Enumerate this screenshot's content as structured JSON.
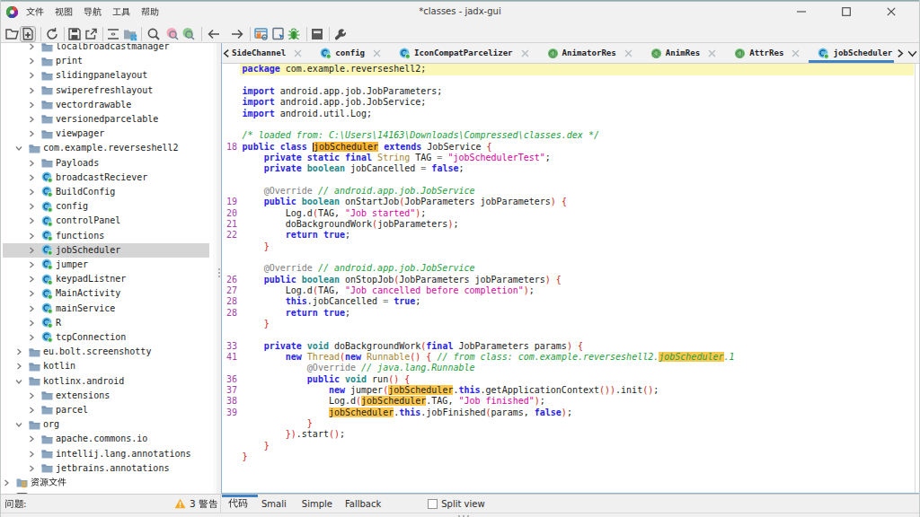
{
  "window": {
    "title": "*classes - jadx-gui",
    "controls": [
      {
        "icon": "minimize-icon"
      },
      {
        "icon": "maximize-icon"
      },
      {
        "icon": "close-icon"
      }
    ]
  },
  "menubar": {
    "items": [
      {
        "label": "文件"
      },
      {
        "label": "视图"
      },
      {
        "label": "导航"
      },
      {
        "label": "工具"
      },
      {
        "label": "帮助"
      }
    ]
  },
  "toolbar": {
    "items": [
      {
        "icon": "open-file-icon"
      },
      {
        "icon": "add-files-icon",
        "boxed": true
      },
      {
        "sep": true
      },
      {
        "icon": "reload-icon"
      },
      {
        "sep": true
      },
      {
        "icon": "save-all-icon"
      },
      {
        "icon": "export-icon"
      },
      {
        "sep": true
      },
      {
        "icon": "flatten-packages-icon"
      },
      {
        "icon": "packages-icon"
      },
      {
        "sep": true
      },
      {
        "icon": "search-icon"
      },
      {
        "icon": "text-search-icon"
      },
      {
        "icon": "class-search-icon"
      },
      {
        "sep": true
      },
      {
        "icon": "back-icon"
      },
      {
        "icon": "forward-icon"
      },
      {
        "sep": true
      },
      {
        "icon": "deobfuscation-icon"
      },
      {
        "icon": "quark-icon"
      },
      {
        "icon": "debug-icon"
      },
      {
        "sep": true
      },
      {
        "icon": "log-viewer-icon"
      },
      {
        "sep": true
      },
      {
        "icon": "settings-icon"
      }
    ]
  },
  "tree": {
    "items": [
      {
        "level": 2,
        "icon": "folder",
        "chev": "right",
        "label": "localbroadcastmanager"
      },
      {
        "level": 2,
        "icon": "folder",
        "chev": "right",
        "label": "print"
      },
      {
        "level": 2,
        "icon": "folder",
        "chev": "right",
        "label": "slidingpanelayout"
      },
      {
        "level": 2,
        "icon": "folder",
        "chev": "right",
        "label": "swiperefreshlayout"
      },
      {
        "level": 2,
        "icon": "folder",
        "chev": "right",
        "label": "vectordrawable"
      },
      {
        "level": 2,
        "icon": "folder",
        "chev": "right",
        "label": "versionedparcelable"
      },
      {
        "level": 2,
        "icon": "folder",
        "chev": "right",
        "label": "viewpager"
      },
      {
        "level": 1,
        "icon": "folder",
        "chev": "down",
        "label": "com.example.reverseshell2"
      },
      {
        "level": 2,
        "icon": "folder",
        "chev": "right",
        "label": "Payloads"
      },
      {
        "level": 2,
        "icon": "class",
        "chev": "right",
        "label": "broadcastReciever"
      },
      {
        "level": 2,
        "icon": "class",
        "chev": "right",
        "label": "BuildConfig"
      },
      {
        "level": 2,
        "icon": "class",
        "chev": "right",
        "label": "config"
      },
      {
        "level": 2,
        "icon": "class",
        "chev": "right",
        "label": "controlPanel"
      },
      {
        "level": 2,
        "icon": "class",
        "chev": "right",
        "label": "functions"
      },
      {
        "level": 2,
        "icon": "class",
        "chev": "right",
        "label": "jobScheduler",
        "selected": true
      },
      {
        "level": 2,
        "icon": "class",
        "chev": "right",
        "label": "jumper"
      },
      {
        "level": 2,
        "icon": "class",
        "chev": "right",
        "label": "keypadListner"
      },
      {
        "level": 2,
        "icon": "class",
        "chev": "right",
        "label": "MainActivity"
      },
      {
        "level": 2,
        "icon": "class",
        "chev": "right",
        "label": "mainService"
      },
      {
        "level": 2,
        "icon": "class",
        "chev": "right",
        "label": "R"
      },
      {
        "level": 2,
        "icon": "class",
        "chev": "right",
        "label": "tcpConnection"
      },
      {
        "level": 1,
        "icon": "folder",
        "chev": "right",
        "label": "eu.bolt.screenshotty"
      },
      {
        "level": 1,
        "icon": "folder",
        "chev": "right",
        "label": "kotlin"
      },
      {
        "level": 1,
        "icon": "folder",
        "chev": "down",
        "label": "kotlinx.android"
      },
      {
        "level": 2,
        "icon": "folder",
        "chev": "right",
        "label": "extensions"
      },
      {
        "level": 2,
        "icon": "folder",
        "chev": "right",
        "label": "parcel"
      },
      {
        "level": 1,
        "icon": "folder",
        "chev": "down",
        "label": "org"
      },
      {
        "level": 2,
        "icon": "folder",
        "chev": "right",
        "label": "apache.commons.io"
      },
      {
        "level": 2,
        "icon": "folder",
        "chev": "right",
        "label": "intellij.lang.annotations"
      },
      {
        "level": 2,
        "icon": "folder",
        "chev": "right",
        "label": "jetbrains.annotations"
      },
      {
        "level": 0,
        "icon": "resfolder",
        "chev": "right",
        "label": "资源文件",
        "cjk": true
      },
      {
        "level": 0,
        "icon": "cert",
        "chev": null,
        "label": "",
        "partial": true
      }
    ]
  },
  "editor": {
    "tabs": [
      {
        "label": "SideChannel",
        "icon": null,
        "closable": true
      },
      {
        "label": "config",
        "icon": "class",
        "closable": true
      },
      {
        "label": "IconCompatParcelizer",
        "icon": "class",
        "closable": true
      },
      {
        "label": "AnimatorRes",
        "icon": "annotation",
        "closable": true
      },
      {
        "label": "AnimRes",
        "icon": "annotation",
        "closable": true
      },
      {
        "label": "AttrRes",
        "icon": "annotation",
        "closable": true
      },
      {
        "label": "jobScheduler",
        "icon": "class",
        "closable": false,
        "active": true
      }
    ],
    "tab_scroll_left": "chevron-left-icon",
    "tab_scroll_right": "chevron-right-icon",
    "tab_list_dropdown": "chevron-down-icon",
    "code_lines": [
      {
        "n": null,
        "cur": true,
        "seg": [
          [
            "k",
            "package "
          ],
          [
            "p",
            "com.example.reverseshell2;"
          ]
        ]
      },
      {
        "n": null,
        "seg": []
      },
      {
        "n": null,
        "seg": [
          [
            "k",
            "import "
          ],
          [
            "p",
            "android.app.job.JobParameters;"
          ]
        ]
      },
      {
        "n": null,
        "seg": [
          [
            "k",
            "import "
          ],
          [
            "p",
            "android.app.job.JobService;"
          ]
        ]
      },
      {
        "n": null,
        "seg": [
          [
            "k",
            "import "
          ],
          [
            "p",
            "android.util.Log;"
          ]
        ]
      },
      {
        "n": null,
        "seg": []
      },
      {
        "n": null,
        "seg": [
          [
            "c",
            "/* loaded from: C:\\Users\\14163\\Downloads\\Compressed\\classes.dex */"
          ]
        ]
      },
      {
        "n": "18",
        "seg": [
          [
            "k",
            "public class "
          ],
          [
            "caret",
            ""
          ],
          [
            "hsel",
            "jobScheduler"
          ],
          [
            "p",
            " "
          ],
          [
            "k",
            "extends"
          ],
          [
            "p",
            " JobService "
          ],
          [
            "r",
            "{"
          ]
        ]
      },
      {
        "n": null,
        "seg": [
          [
            "k",
            "    private static final "
          ],
          [
            "y",
            "String"
          ],
          [
            "p",
            " TAG "
          ],
          [
            "o",
            "="
          ],
          [
            "p",
            " "
          ],
          [
            "s",
            "\"jobSchedulerTest\""
          ],
          [
            "p",
            ";"
          ]
        ]
      },
      {
        "n": null,
        "seg": [
          [
            "k",
            "    private "
          ],
          [
            "t",
            "boolean"
          ],
          [
            "p",
            " jobCancelled "
          ],
          [
            "o",
            "="
          ],
          [
            "p",
            " "
          ],
          [
            "k",
            "false"
          ],
          [
            "p",
            ";"
          ]
        ]
      },
      {
        "n": null,
        "seg": []
      },
      {
        "n": null,
        "seg": [
          [
            "a",
            "    @Override "
          ],
          [
            "c",
            "// android.app.job.JobService"
          ]
        ]
      },
      {
        "n": "19",
        "seg": [
          [
            "k",
            "    public "
          ],
          [
            "t",
            "boolean"
          ],
          [
            "p",
            " onStartJob"
          ],
          [
            "r",
            "("
          ],
          [
            "p",
            "JobParameters jobParameters"
          ],
          [
            "r",
            ")"
          ],
          [
            "p",
            " "
          ],
          [
            "r",
            "{"
          ]
        ]
      },
      {
        "n": "20",
        "seg": [
          [
            "p",
            "        Log.d"
          ],
          [
            "r",
            "("
          ],
          [
            "p",
            "TAG, "
          ],
          [
            "s",
            "\"Job started\""
          ],
          [
            "r",
            ")"
          ],
          [
            "p",
            ";"
          ]
        ]
      },
      {
        "n": "21",
        "seg": [
          [
            "p",
            "        doBackgroundWork"
          ],
          [
            "r",
            "("
          ],
          [
            "p",
            "jobParameters"
          ],
          [
            "r",
            ")"
          ],
          [
            "p",
            ";"
          ]
        ]
      },
      {
        "n": "22",
        "seg": [
          [
            "k",
            "        return true"
          ],
          [
            "p",
            ";"
          ]
        ]
      },
      {
        "n": null,
        "seg": [
          [
            "r",
            "    }"
          ]
        ]
      },
      {
        "n": null,
        "seg": []
      },
      {
        "n": null,
        "seg": [
          [
            "a",
            "    @Override "
          ],
          [
            "c",
            "// android.app.job.JobService"
          ]
        ]
      },
      {
        "n": "26",
        "seg": [
          [
            "k",
            "    public "
          ],
          [
            "t",
            "boolean"
          ],
          [
            "p",
            " onStopJob"
          ],
          [
            "r",
            "("
          ],
          [
            "p",
            "JobParameters jobParameters"
          ],
          [
            "r",
            ")"
          ],
          [
            "p",
            " "
          ],
          [
            "r",
            "{"
          ]
        ]
      },
      {
        "n": "27",
        "seg": [
          [
            "p",
            "        Log.d"
          ],
          [
            "r",
            "("
          ],
          [
            "p",
            "TAG, "
          ],
          [
            "s",
            "\"Job cancelled before completion\""
          ],
          [
            "r",
            ")"
          ],
          [
            "p",
            ";"
          ]
        ]
      },
      {
        "n": "28",
        "seg": [
          [
            "k",
            "        this"
          ],
          [
            "p",
            ".jobCancelled "
          ],
          [
            "o",
            "="
          ],
          [
            "p",
            " "
          ],
          [
            "k",
            "true"
          ],
          [
            "p",
            ";"
          ]
        ]
      },
      {
        "n": "28",
        "seg": [
          [
            "k",
            "        return true"
          ],
          [
            "p",
            ";"
          ]
        ]
      },
      {
        "n": null,
        "seg": [
          [
            "r",
            "    }"
          ]
        ]
      },
      {
        "n": null,
        "seg": []
      },
      {
        "n": "33",
        "seg": [
          [
            "k",
            "    private "
          ],
          [
            "t",
            "void"
          ],
          [
            "p",
            " doBackgroundWork"
          ],
          [
            "r",
            "("
          ],
          [
            "k",
            "final"
          ],
          [
            "p",
            " JobParameters params"
          ],
          [
            "r",
            ")"
          ],
          [
            "p",
            " "
          ],
          [
            "r",
            "{"
          ]
        ]
      },
      {
        "n": "41",
        "seg": [
          [
            "k",
            "        new "
          ],
          [
            "y",
            "Thread"
          ],
          [
            "r",
            "("
          ],
          [
            "k",
            "new"
          ],
          [
            "p",
            " "
          ],
          [
            "y",
            "Runnable"
          ],
          [
            "r",
            "()"
          ],
          [
            "p",
            " "
          ],
          [
            "r",
            "{"
          ],
          [
            "p",
            " "
          ],
          [
            "c",
            "// from class: com.example.reverseshell2."
          ],
          [
            "hc",
            "jobScheduler"
          ],
          [
            "c",
            ".1"
          ]
        ]
      },
      {
        "n": null,
        "seg": [
          [
            "a",
            "            @Override "
          ],
          [
            "c",
            "// java.lang.Runnable"
          ]
        ]
      },
      {
        "n": "36",
        "seg": [
          [
            "k",
            "            public "
          ],
          [
            "t",
            "void"
          ],
          [
            "p",
            " run"
          ],
          [
            "r",
            "()"
          ],
          [
            "p",
            " "
          ],
          [
            "r",
            "{"
          ]
        ]
      },
      {
        "n": "37",
        "seg": [
          [
            "k",
            "                new "
          ],
          [
            "p",
            "jumper"
          ],
          [
            "r",
            "("
          ],
          [
            "h",
            "jobScheduler"
          ],
          [
            "p",
            "."
          ],
          [
            "k",
            "this"
          ],
          [
            "p",
            ".getApplicationContext"
          ],
          [
            "r",
            "())"
          ],
          [
            "p",
            ".init"
          ],
          [
            "r",
            "()"
          ],
          [
            "p",
            ";"
          ]
        ]
      },
      {
        "n": "38",
        "seg": [
          [
            "p",
            "                Log.d"
          ],
          [
            "r",
            "("
          ],
          [
            "h",
            "jobScheduler"
          ],
          [
            "p",
            ".TAG, "
          ],
          [
            "s",
            "\"Job finished\""
          ],
          [
            "r",
            ")"
          ],
          [
            "p",
            ";"
          ]
        ]
      },
      {
        "n": "39",
        "seg": [
          [
            "p",
            "                "
          ],
          [
            "h",
            "jobScheduler"
          ],
          [
            "p",
            "."
          ],
          [
            "k",
            "this"
          ],
          [
            "p",
            ".jobFinished"
          ],
          [
            "r",
            "("
          ],
          [
            "p",
            "params, "
          ],
          [
            "k",
            "false"
          ],
          [
            "r",
            ")"
          ],
          [
            "p",
            ";"
          ]
        ]
      },
      {
        "n": null,
        "seg": [
          [
            "r",
            "            }"
          ]
        ]
      },
      {
        "n": null,
        "seg": [
          [
            "r",
            "        })"
          ],
          [
            "p",
            ".start"
          ],
          [
            "r",
            "()"
          ],
          [
            "p",
            ";"
          ]
        ]
      },
      {
        "n": null,
        "seg": [
          [
            "r",
            "    }"
          ]
        ]
      },
      {
        "n": null,
        "seg": [
          [
            "r",
            "}"
          ]
        ]
      }
    ]
  },
  "status_bar": {
    "issues_label": "问题:",
    "warning_icon": "warning-triangle-icon",
    "warnings_text": "3 警告",
    "warning_count": 3
  },
  "mode_tabs": {
    "items": [
      {
        "label": "代码",
        "active": true,
        "cjk": true
      },
      {
        "label": "Smali"
      },
      {
        "label": "Simple"
      },
      {
        "label": "Fallback"
      }
    ],
    "split_view_label": "Split view",
    "split_view_checked": false
  },
  "colors": {
    "accent_blue": "#3f83c5",
    "keyword": "#2a1fe8",
    "type": "#1f8a8c",
    "string": "#dc009c",
    "comment": "#1e9e3e",
    "annotation": "#808080",
    "bracket": "#cf2417",
    "class_ref": "#a6862e",
    "line_number": "#a23fa8",
    "occurrence_bg": "#ffc84d",
    "selected_occurrence_bg": "#ffb632",
    "current_line_bg": "#fbf7b8",
    "tree_selection_bg": "#d5d5d5",
    "warning_orange": "#f5a623"
  }
}
